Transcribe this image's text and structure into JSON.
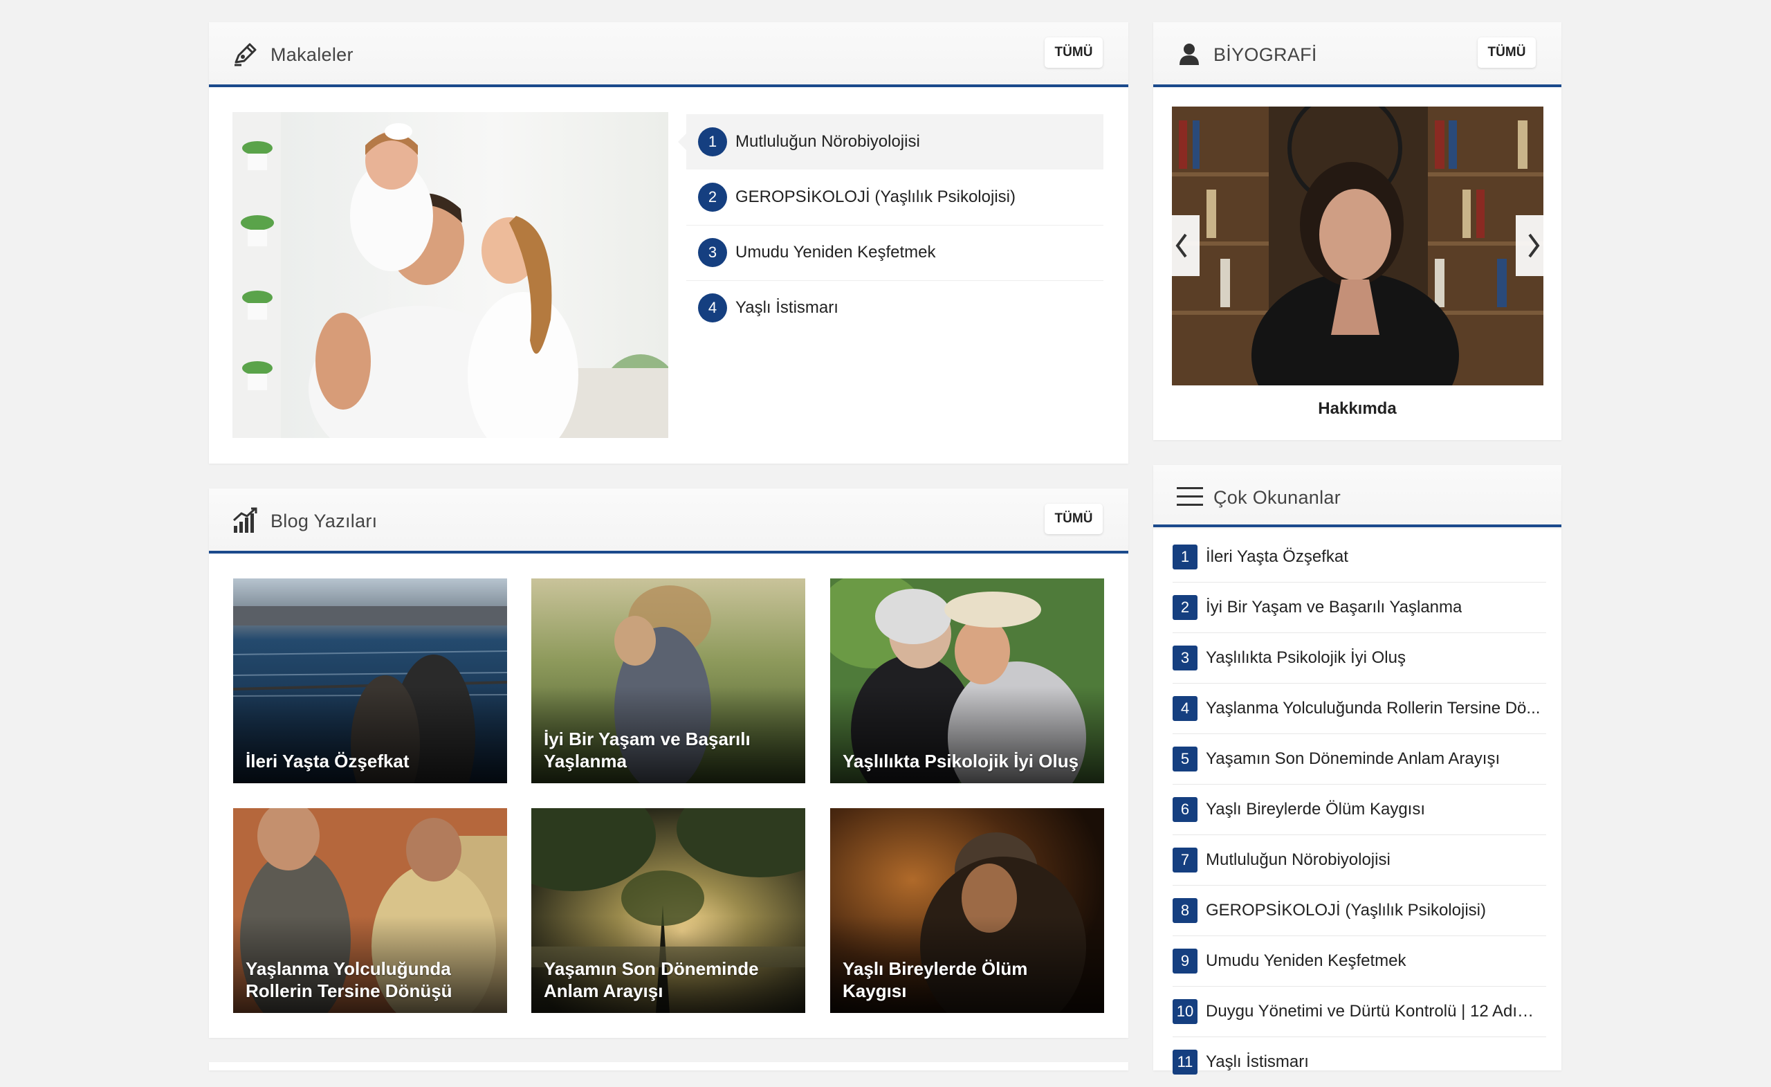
{
  "articles": {
    "title": "Makaleler",
    "all_label": "TÜMÜ",
    "items": [
      {
        "num": "1",
        "label": "Mutluluğun Nörobiyolojisi"
      },
      {
        "num": "2",
        "label": "GEROPSİKOLOJİ (Yaşlılık Psikolojisi)"
      },
      {
        "num": "3",
        "label": "Umudu Yeniden Keşfetmek"
      },
      {
        "num": "4",
        "label": "Yaşlı İstismarı"
      }
    ]
  },
  "blog": {
    "title": "Blog Yazıları",
    "all_label": "TÜMÜ",
    "cards": [
      {
        "title": "İleri Yaşta Özşefkat"
      },
      {
        "title": "İyi Bir Yaşam ve Başarılı Yaşlanma"
      },
      {
        "title": "Yaşlılıkta Psikolojik İyi Oluş"
      },
      {
        "title": "Yaşlanma Yolculuğunda Rollerin Tersine Dönüşü"
      },
      {
        "title": "Yaşamın Son Döneminde Anlam Arayışı"
      },
      {
        "title": "Yaşlı Bireylerde Ölüm Kaygısı"
      }
    ]
  },
  "bio": {
    "title": "BİYOGRAFİ",
    "all_label": "TÜMÜ",
    "caption": "Hakkımda"
  },
  "most_read": {
    "title": "Çok Okunanlar",
    "items": [
      {
        "num": "1",
        "label": "İleri Yaşta Özşefkat"
      },
      {
        "num": "2",
        "label": "İyi Bir Yaşam ve Başarılı Yaşlanma"
      },
      {
        "num": "3",
        "label": "Yaşlılıkta Psikolojik İyi Oluş"
      },
      {
        "num": "4",
        "label": "Yaşlanma Yolculuğunda Rollerin Tersine Dö..."
      },
      {
        "num": "5",
        "label": "Yaşamın Son Döneminde Anlam Arayışı"
      },
      {
        "num": "6",
        "label": "Yaşlı Bireylerde Ölüm Kaygısı"
      },
      {
        "num": "7",
        "label": "Mutluluğun Nörobiyolojisi"
      },
      {
        "num": "8",
        "label": "GEROPSİKOLOJİ (Yaşlılık Psikolojisi)"
      },
      {
        "num": "9",
        "label": "Umudu Yeniden Keşfetmek"
      },
      {
        "num": "10",
        "label": "Duygu Yönetimi ve Dürtü Kontrolü | 12 Adımd..."
      },
      {
        "num": "11",
        "label": "Yaşlı İstismarı"
      }
    ]
  },
  "colors": {
    "accent": "#1b4a8c",
    "badge": "#153f80",
    "background": "#f2f2f2"
  }
}
